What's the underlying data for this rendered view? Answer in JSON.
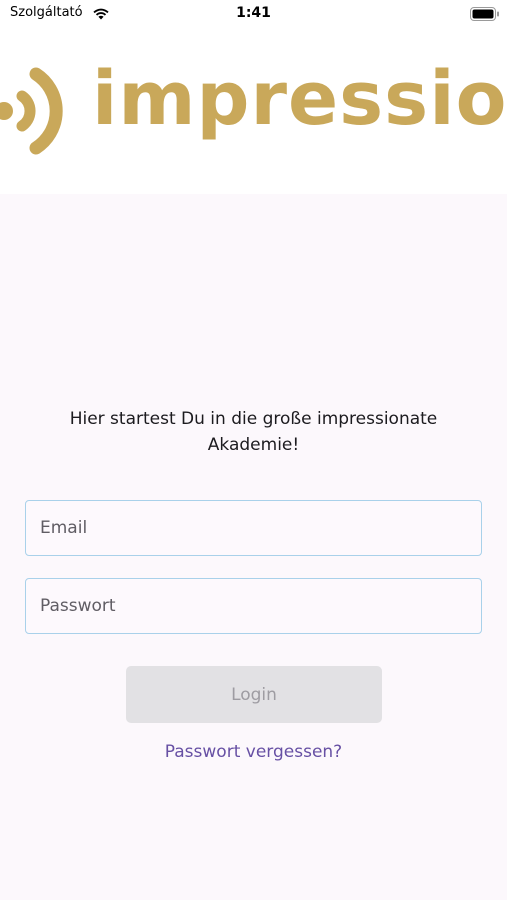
{
  "status_bar": {
    "carrier": "Szolgáltató",
    "time": "1:41"
  },
  "header": {
    "logo_text": "impressionate"
  },
  "main": {
    "welcome_text": "Hier startest Du in die große impressionate Akademie!",
    "email_placeholder": "Email",
    "email_value": "",
    "password_placeholder": "Passwort",
    "password_value": "",
    "login_label": "Login",
    "forgot_password_label": "Passwort vergessen?"
  },
  "colors": {
    "brand_gold": "#c9a85a",
    "link_purple": "#6750a4",
    "field_border": "#a9d1ea",
    "background": "#fcf8fc",
    "disabled_button": "#e2e1e4"
  },
  "icons": {
    "wifi": "wifi-icon",
    "battery": "battery-icon",
    "logo_mark": "sound-waves-icon"
  }
}
